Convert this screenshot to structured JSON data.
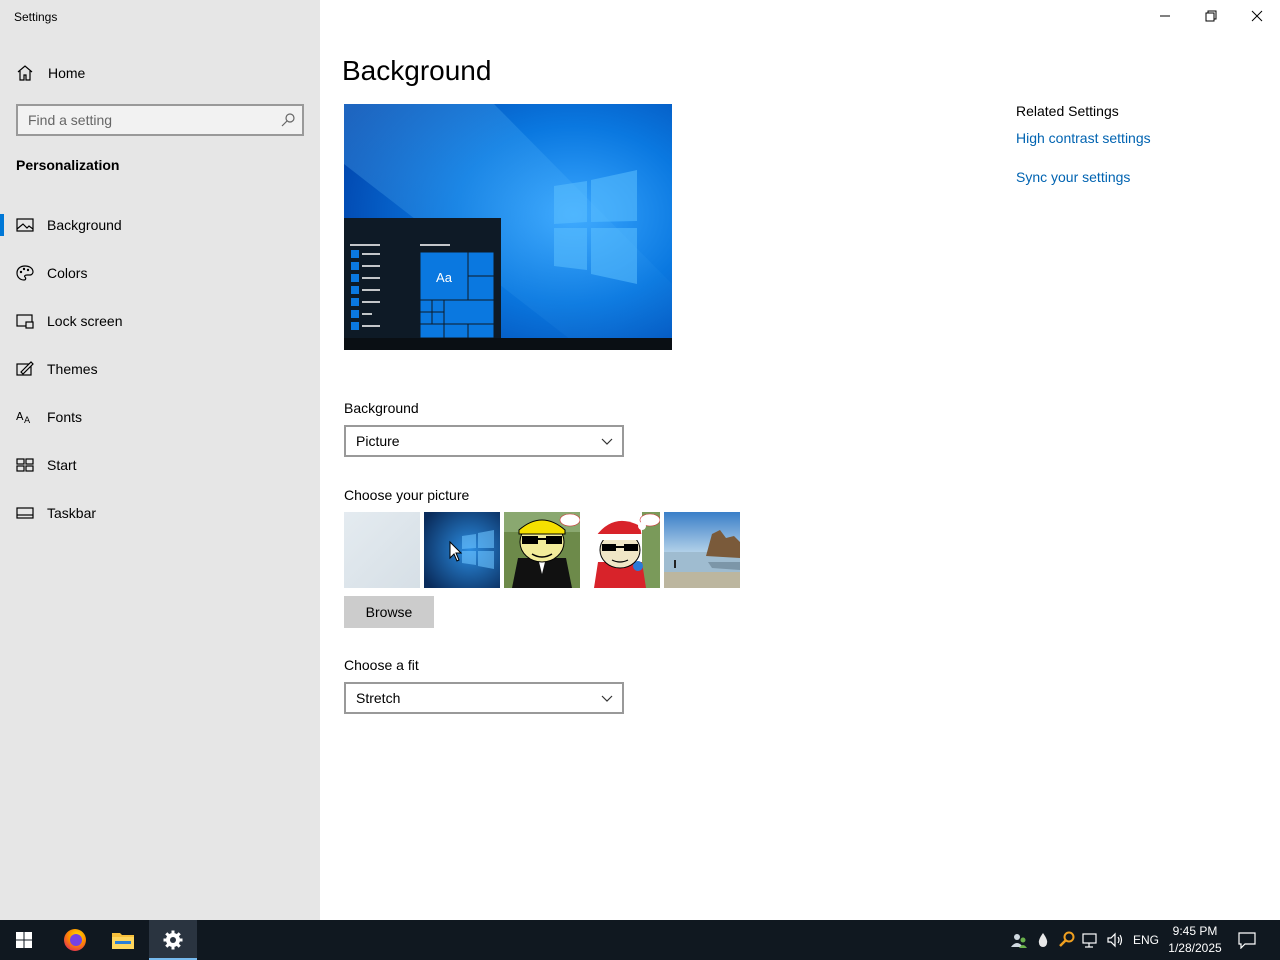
{
  "window": {
    "title": "Settings",
    "controls": [
      "minimize-icon",
      "restore-icon",
      "close-icon"
    ]
  },
  "sidebar": {
    "home_label": "Home",
    "search_placeholder": "Find a setting",
    "section_title": "Personalization",
    "items": [
      {
        "label": "Background",
        "icon": "picture-icon",
        "selected": true
      },
      {
        "label": "Colors",
        "icon": "palette-icon",
        "selected": false
      },
      {
        "label": "Lock screen",
        "icon": "lock-screen-icon",
        "selected": false
      },
      {
        "label": "Themes",
        "icon": "brush-icon",
        "selected": false
      },
      {
        "label": "Fonts",
        "icon": "font-icon",
        "selected": false
      },
      {
        "label": "Start",
        "icon": "start-tiles-icon",
        "selected": false
      },
      {
        "label": "Taskbar",
        "icon": "taskbar-icon",
        "selected": false
      }
    ]
  },
  "main": {
    "title": "Background",
    "preview": {
      "tile_text": "Aa"
    },
    "background_label": "Background",
    "background_value": "Picture",
    "choose_picture_label": "Choose your picture",
    "pictures": [
      "pale-blank",
      "windows-blue",
      "cartoon-sunglasses",
      "cartoon-santa",
      "beach-rocks"
    ],
    "browse_label": "Browse",
    "fit_label": "Choose a fit",
    "fit_value": "Stretch"
  },
  "related": {
    "title": "Related Settings",
    "links": [
      "High contrast settings",
      "Sync your settings"
    ]
  },
  "taskbar": {
    "pinned": [
      "windows-start-icon",
      "firefox-icon",
      "file-explorer-icon",
      "settings-gear-icon"
    ],
    "tray_icons": [
      "people-icon",
      "droplet-icon",
      "search-key-icon",
      "network-icon",
      "volume-icon"
    ],
    "language": "ENG",
    "time": "9:45 PM",
    "date": "1/28/2025",
    "notification_icon": "action-center-icon"
  },
  "colors": {
    "accent": "#0078d7",
    "link": "#0063b1",
    "sidebar_bg": "#e6e6e6",
    "taskbar_bg": "#101820"
  }
}
